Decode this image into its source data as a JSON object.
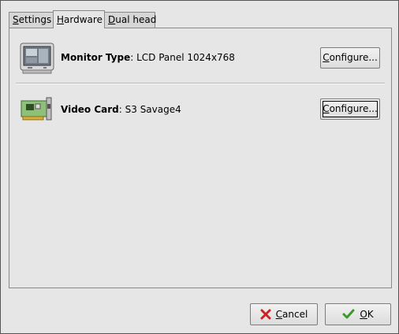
{
  "tabs": [
    {
      "prefix": "",
      "mnemonic": "S",
      "rest": "ettings"
    },
    {
      "prefix": "",
      "mnemonic": "H",
      "rest": "ardware"
    },
    {
      "prefix": "",
      "mnemonic": "D",
      "rest": "ual head"
    }
  ],
  "active_tab": "Hardware",
  "hardware": {
    "monitor": {
      "label": "Monitor Type",
      "value": ": LCD Panel 1024x768",
      "configure_mnemonic": "C",
      "configure_rest": "onfigure..."
    },
    "video": {
      "label": "Video Card",
      "value": ": S3 Savage4",
      "configure_mnemonic": "C",
      "configure_rest": "onfigure..."
    }
  },
  "buttons": {
    "cancel_mnemonic": "C",
    "cancel_rest": "ancel",
    "ok_mnemonic": "O",
    "ok_rest": "K"
  },
  "icons": {
    "monitor": "monitor-icon",
    "video_card": "video-card-icon",
    "cancel": "red-x-icon",
    "ok": "green-check-icon"
  },
  "colors": {
    "cancel_icon": "#cc2222",
    "ok_icon": "#3a9a2a"
  }
}
